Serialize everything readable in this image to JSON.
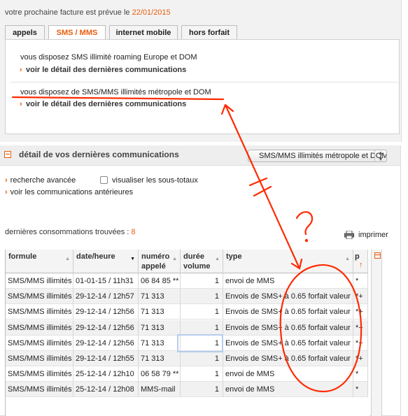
{
  "bill": {
    "text": "votre prochaine facture est prévue le ",
    "date": "22/01/2015"
  },
  "tabs": [
    {
      "label": "appels",
      "active": false
    },
    {
      "label": "SMS / MMS",
      "active": true
    },
    {
      "label": "internet mobile",
      "active": false
    },
    {
      "label": "hors forfait",
      "active": false
    }
  ],
  "offers": [
    {
      "text": "vous disposez SMS illimité roaming Europe et DOM",
      "link": "voir le détail des dernières communications"
    },
    {
      "text": "vous disposez de SMS/MMS illimités métropole et DOM",
      "link": "voir le détail des dernières communications"
    }
  ],
  "section": {
    "collapse_symbol": "−",
    "title": "détail de vos dernières communications",
    "filter_value": "SMS/MMS illimités métropole et DOM",
    "advanced_search": "recherche avancée",
    "subtotals": "visualiser les sous-totaux",
    "previous": "voir les communications antérieures",
    "found_label": "dernières consommations trouvées : ",
    "found_count": "8",
    "print_label": "imprimer"
  },
  "table": {
    "headers": [
      "formule",
      "date/heure",
      "numéro appelé",
      "durée volume",
      "type",
      "p"
    ],
    "rows": [
      [
        "SMS/MMS illimités métropole et DOM",
        "01-01-15 / 11h31",
        "06 84 85 **",
        "1",
        "envoi de MMS",
        "*"
      ],
      [
        "SMS/MMS illimités métropole et DOM",
        "29-12-14 / 12h57",
        "71 313",
        "1",
        "Envois de SMS+ à 0.65 forfait valeur",
        "*+"
      ],
      [
        "SMS/MMS illimités métropole et DOM",
        "29-12-14 / 12h56",
        "71 313",
        "1",
        "Envois de SMS+ à 0.65 forfait valeur",
        "*+"
      ],
      [
        "SMS/MMS illimités métropole et DOM",
        "29-12-14 / 12h56",
        "71 313",
        "1",
        "Envois de SMS+ à 0.65 forfait valeur",
        "*+"
      ],
      [
        "SMS/MMS illimités métropole et DOM",
        "29-12-14 / 12h56",
        "71 313",
        "1",
        "Envois de SMS+ à 0.65 forfait valeur",
        "*+"
      ],
      [
        "SMS/MMS illimités métropole et DOM",
        "29-12-14 / 12h55",
        "71 313",
        "1",
        "Envois de SMS+ à 0.65 forfait valeur",
        "*+"
      ],
      [
        "SMS/MMS illimités métropole et DOM",
        "25-12-14 / 12h10",
        "06 58 79 **",
        "1",
        "envoi de MMS",
        "*"
      ],
      [
        "SMS/MMS illimités métropole et DOM",
        "25-12-14 / 12h08",
        "MMS-mail",
        "1",
        "envoi de MMS",
        "*"
      ]
    ]
  },
  "annotation": {
    "question_mark": "?",
    "color": "#ff2a00"
  },
  "colors": {
    "accent": "#e85c0c",
    "panel": "#f2f2f2"
  }
}
